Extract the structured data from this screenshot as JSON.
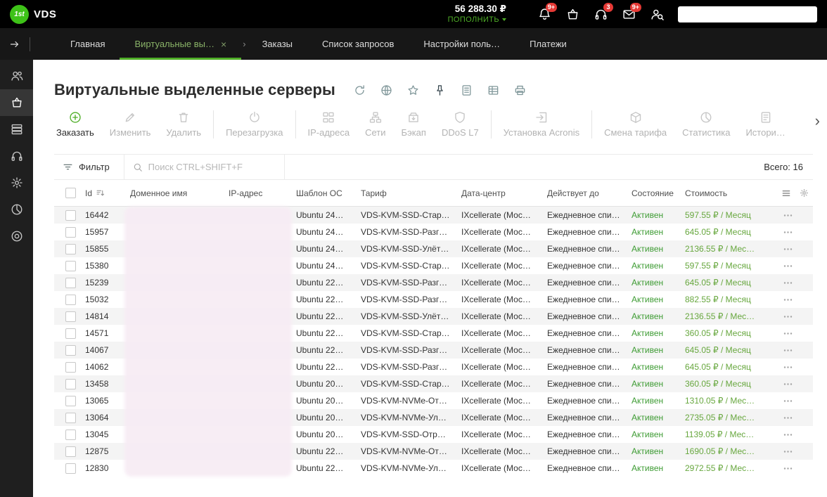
{
  "topbar": {
    "logo": {
      "prefix": "1st",
      "text": "VDS"
    },
    "balance": "56 288.30 ₽",
    "topup_label": "ПОПОЛНИТЬ",
    "search_value": "",
    "icons": [
      {
        "icon": "bell",
        "badge": "9+"
      },
      {
        "icon": "basket",
        "badge": ""
      },
      {
        "icon": "headset",
        "badge": "3"
      },
      {
        "icon": "mail",
        "badge": "9+"
      },
      {
        "icon": "person-search",
        "badge": ""
      }
    ]
  },
  "glyphs": {
    "close": "×",
    "chevron_right": "›",
    "scroll_right": "›"
  },
  "tabs": [
    {
      "label": "Главная",
      "active": false,
      "closable": false
    },
    {
      "label": "Виртуальные вы…",
      "active": true,
      "closable": true
    },
    {
      "label": "Заказы",
      "active": false,
      "closable": false
    },
    {
      "label": "Список запросов",
      "active": false,
      "closable": false
    },
    {
      "label": "Настройки поль…",
      "active": false,
      "closable": false
    },
    {
      "label": "Платежи",
      "active": false,
      "closable": false
    }
  ],
  "sidebar": {
    "items": [
      {
        "icon": "users",
        "active": false
      },
      {
        "icon": "basket",
        "active": true
      },
      {
        "icon": "stack",
        "active": false
      },
      {
        "icon": "headset",
        "active": false
      },
      {
        "icon": "gear",
        "active": false
      },
      {
        "icon": "pie",
        "active": false
      },
      {
        "icon": "disc",
        "active": false
      }
    ]
  },
  "page": {
    "title": "Виртуальные выделенные серверы",
    "title_icons": [
      "refresh",
      "globe",
      "star",
      "pin",
      "doc",
      "tabledoc",
      "printer"
    ]
  },
  "toolbar": {
    "groups": [
      {
        "buttons": [
          {
            "name": "order",
            "label": "Заказать",
            "icon": "plus-circle",
            "enabled": true
          },
          {
            "name": "edit",
            "label": "Изменить",
            "icon": "pencil",
            "enabled": false
          },
          {
            "name": "delete",
            "label": "Удалить",
            "icon": "trash",
            "enabled": false
          }
        ]
      },
      {
        "buttons": [
          {
            "name": "reboot",
            "label": "Перезагрузка",
            "icon": "restart",
            "enabled": false
          }
        ]
      },
      {
        "buttons": [
          {
            "name": "ip-addresses",
            "label": "IP-адреса",
            "icon": "ip",
            "enabled": false
          },
          {
            "name": "networks",
            "label": "Сети",
            "icon": "network",
            "enabled": false
          },
          {
            "name": "backup",
            "label": "Бэкап",
            "icon": "backup",
            "enabled": false
          },
          {
            "name": "ddos-l7",
            "label": "DDoS L7",
            "icon": "shield",
            "enabled": false
          }
        ]
      },
      {
        "buttons": [
          {
            "name": "acronis-install",
            "label": "Установка Acronis",
            "icon": "install",
            "enabled": false
          }
        ]
      },
      {
        "buttons": [
          {
            "name": "tariff-change",
            "label": "Смена тарифа",
            "icon": "tariff",
            "enabled": false
          },
          {
            "name": "statistics",
            "label": "Статистика",
            "icon": "pie",
            "enabled": false
          },
          {
            "name": "history",
            "label": "Истори…",
            "icon": "history",
            "enabled": false
          }
        ]
      }
    ]
  },
  "filter": {
    "label": "Фильтр",
    "search_placeholder": "Поиск CTRL+SHIFT+F",
    "total": "Всего: 16"
  },
  "table": {
    "columns": [
      "Id",
      "Доменное имя",
      "IP-адрес",
      "Шаблон ОС",
      "Тариф",
      "Дата-центр",
      "Действует до",
      "Состояние",
      "Стоимость"
    ],
    "rows": [
      {
        "id": "16442",
        "domain": "",
        "ip": "",
        "os": "Ubuntu 24…",
        "tariff": "VDS-KVM-SSD-Старт-…",
        "dc": "IXcellerate (Мос…",
        "valid": "Ежедневное спис…",
        "status": "Активен",
        "price": "597.55 ₽ / Месяц"
      },
      {
        "id": "15957",
        "domain": "",
        "ip": "",
        "os": "Ubuntu 24…",
        "tariff": "VDS-KVM-SSD-Разгон-…",
        "dc": "IXcellerate (Мос…",
        "valid": "Ежедневное спис…",
        "status": "Активен",
        "price": "645.05 ₽ / Месяц"
      },
      {
        "id": "15855",
        "domain": "",
        "ip": "",
        "os": "Ubuntu 24…",
        "tariff": "VDS-KVM-SSD-Улёт-1…",
        "dc": "IXcellerate (Мос…",
        "valid": "Ежедневное спис…",
        "status": "Активен",
        "price": "2136.55 ₽ / Мес…"
      },
      {
        "id": "15380",
        "domain": "",
        "ip": "",
        "os": "Ubuntu 24…",
        "tariff": "VDS-KVM-SSD-Старт-…",
        "dc": "IXcellerate (Мос…",
        "valid": "Ежедневное спис…",
        "status": "Активен",
        "price": "597.55 ₽ / Месяц"
      },
      {
        "id": "15239",
        "domain": "",
        "ip": "",
        "os": "Ubuntu 22…",
        "tariff": "VDS-KVM-SSD-Разгон-…",
        "dc": "IXcellerate (Мос…",
        "valid": "Ежедневное спис…",
        "status": "Активен",
        "price": "645.05 ₽ / Месяц"
      },
      {
        "id": "15032",
        "domain": "",
        "ip": "",
        "os": "Ubuntu 22…",
        "tariff": "VDS-KVM-SSD-Разгон-…",
        "dc": "IXcellerate (Мос…",
        "valid": "Ежедневное спис…",
        "status": "Активен",
        "price": "882.55 ₽ / Месяц"
      },
      {
        "id": "14814",
        "domain": "",
        "ip": "",
        "os": "Ubuntu 22…",
        "tariff": "VDS-KVM-SSD-Улёт-1…",
        "dc": "IXcellerate (Мос…",
        "valid": "Ежедневное спис…",
        "status": "Активен",
        "price": "2136.55 ₽ / Мес…"
      },
      {
        "id": "14571",
        "domain": "",
        "ip": "",
        "os": "Ubuntu 22…",
        "tariff": "VDS-KVM-SSD-Старт-…",
        "dc": "IXcellerate (Мос…",
        "valid": "Ежедневное спис…",
        "status": "Активен",
        "price": "360.05 ₽ / Месяц"
      },
      {
        "id": "14067",
        "domain": "",
        "ip": "",
        "os": "Ubuntu 22…",
        "tariff": "VDS-KVM-SSD-Разгон-…",
        "dc": "IXcellerate (Мос…",
        "valid": "Ежедневное спис…",
        "status": "Активен",
        "price": "645.05 ₽ / Месяц"
      },
      {
        "id": "14062",
        "domain": "",
        "ip": "",
        "os": "Ubuntu 22…",
        "tariff": "VDS-KVM-SSD-Разгон-…",
        "dc": "IXcellerate (Мос…",
        "valid": "Ежедневное спис…",
        "status": "Активен",
        "price": "645.05 ₽ / Месяц"
      },
      {
        "id": "13458",
        "domain": "",
        "ip": "",
        "os": "Ubuntu 20…",
        "tariff": "VDS-KVM-SSD-Старт-…",
        "dc": "IXcellerate (Мос…",
        "valid": "Ежедневное спис…",
        "status": "Активен",
        "price": "360.05 ₽ / Месяц"
      },
      {
        "id": "13065",
        "domain": "",
        "ip": "",
        "os": "Ubuntu 20…",
        "tariff": "VDS-KVM-NVMe-Отр…",
        "dc": "IXcellerate (Мос…",
        "valid": "Ежедневное спис…",
        "status": "Активен",
        "price": "1310.05 ₽ / Мес…"
      },
      {
        "id": "13064",
        "domain": "",
        "ip": "",
        "os": "Ubuntu 20…",
        "tariff": "VDS-KVM-NVMe-Улёт…",
        "dc": "IXcellerate (Мос…",
        "valid": "Ежедневное спис…",
        "status": "Активен",
        "price": "2735.05 ₽ / Мес…"
      },
      {
        "id": "13045",
        "domain": "",
        "ip": "",
        "os": "Ubuntu 20…",
        "tariff": "VDS-KVM-SSD-Отрыв…",
        "dc": "IXcellerate (Мос…",
        "valid": "Ежедневное спис…",
        "status": "Активен",
        "price": "1139.05 ₽ / Мес…"
      },
      {
        "id": "12875",
        "domain": "",
        "ip": "",
        "os": "Ubuntu 22…",
        "tariff": "VDS-KVM-NVMe-Отр…",
        "dc": "IXcellerate (Мос…",
        "valid": "Ежедневное спис…",
        "status": "Активен",
        "price": "1690.05 ₽ / Мес…"
      },
      {
        "id": "12830",
        "domain": "",
        "ip": "",
        "os": "Ubuntu 22…",
        "tariff": "VDS-KVM-NVMe-Улёт…",
        "dc": "IXcellerate (Мос…",
        "valid": "Ежедневное спис…",
        "status": "Активен",
        "price": "2972.55 ₽ / Мес…"
      }
    ]
  },
  "colors": {
    "accent_green": "#4fae27",
    "logo_green": "#3ec218",
    "status_green": "#3f9c35",
    "price_green": "#67a73e",
    "badge_red": "#e53935"
  }
}
